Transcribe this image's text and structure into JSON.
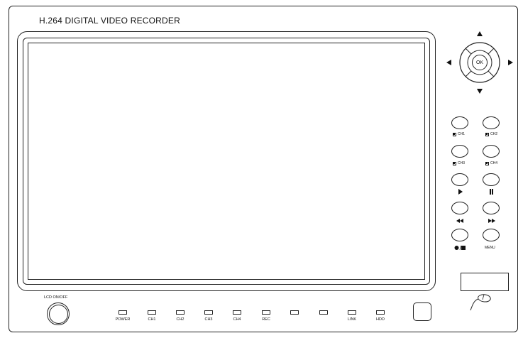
{
  "device": {
    "title": "H.264 DIGITAL VIDEO RECORDER",
    "lcd_label": "LCD ON/OFF"
  },
  "dpad": {
    "center_label": "OK",
    "icons": [
      "arrow-up-icon",
      "arrow-down-icon",
      "arrow-left-icon",
      "arrow-right-icon"
    ]
  },
  "side_buttons": [
    {
      "name": "ch1-button",
      "label": "CH1",
      "icon": "quad-view-icon"
    },
    {
      "name": "ch2-button",
      "label": "CH2",
      "icon": "quad-view-icon"
    },
    {
      "name": "ch3-button",
      "label": "CH3",
      "icon": "quad-view-icon"
    },
    {
      "name": "ch4-button",
      "label": "CH4",
      "icon": "quad-view-icon"
    },
    {
      "name": "play-button",
      "label": "",
      "icon": "play-icon"
    },
    {
      "name": "pause-button",
      "label": "",
      "icon": "pause-icon"
    },
    {
      "name": "rewind-button",
      "label": "",
      "icon": "rewind-icon"
    },
    {
      "name": "fast-forward-button",
      "label": "",
      "icon": "fast-forward-icon"
    },
    {
      "name": "record-stop-button",
      "label": "",
      "icon": "record-stop-icon"
    },
    {
      "name": "menu-button",
      "label": "MENU",
      "icon": ""
    }
  ],
  "leds": [
    {
      "label": "POWER"
    },
    {
      "label": "CH1"
    },
    {
      "label": "CH2"
    },
    {
      "label": "CH3"
    },
    {
      "label": "CH4"
    },
    {
      "label": "REC"
    },
    {
      "label": ""
    },
    {
      "label": ""
    },
    {
      "label": "LINK"
    },
    {
      "label": "HDD"
    }
  ]
}
